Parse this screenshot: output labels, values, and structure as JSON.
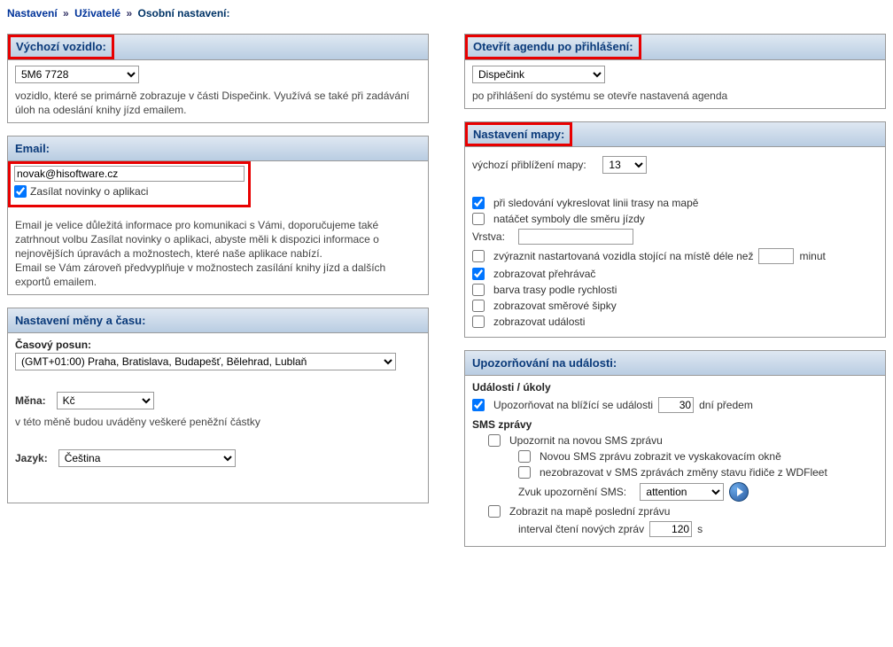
{
  "breadcrumb": {
    "link1": "Nastavení",
    "link2": "Uživatelé",
    "current": "Osobní nastavení:"
  },
  "vehicle": {
    "header": "Výchozí vozidlo:",
    "selected": "5M6 7728",
    "desc": "vozidlo, které se primárně zobrazuje v části Dispečink. Využívá se také při zadávání úloh na odeslání knihy jízd emailem."
  },
  "agenda": {
    "header": "Otevřít agendu po přihlášení:",
    "selected": "Dispečink",
    "desc": "po přihlášení do systému se otevře nastavená agenda"
  },
  "email": {
    "header": "Email:",
    "value": "novak@hisoftware.cz",
    "newsletter": "Zasílat novinky o aplikaci",
    "desc": "Email je velice důležitá informace pro komunikaci s Vámi, doporučujeme také zatrhnout volbu Zasílat novinky o aplikaci, abyste měli k dispozici informace o nejnovějších úpravách a možnostech, které naše aplikace nabízí.\nEmail se Vám zároveň předvyplňuje v možnostech zasílání knihy jízd a dalších exportů emailem."
  },
  "map": {
    "header": "Nastavení mapy:",
    "zoom_label": "výchozí přiblížení mapy:",
    "zoom": "13",
    "track_line": "při sledování vykreslovat linii trasy na mapě",
    "rotate_symbols": "natáčet symboly dle směru jízdy",
    "layer_label": "Vrstva:",
    "layer": "",
    "highlight_label_pre": "zvýraznit nastartovaná vozidla stojící na místě déle než",
    "highlight_val": "",
    "highlight_label_post": "minut",
    "player": "zobrazovat přehrávač",
    "color_speed": "barva trasy podle rychlosti",
    "arrows": "zobrazovat směrové šipky",
    "events": "zobrazovat události"
  },
  "currency": {
    "header": "Nastavení měny a času:",
    "tz_label": "Časový posun:",
    "tz": "(GMT+01:00) Praha, Bratislava, Budapešť, Bělehrad, Lublaň",
    "curr_label": "Měna:",
    "curr": "Kč",
    "curr_desc": "v této měně budou uváděny veškeré peněžní částky",
    "lang_label": "Jazyk:",
    "lang": "Čeština"
  },
  "notify": {
    "header": "Upozorňování na události:",
    "events_head": "Události / úkoly",
    "notify_upcoming_pre": "Upozorňovat na blížící se události",
    "days": "30",
    "notify_upcoming_post": "dní předem",
    "sms_head": "SMS zprávy",
    "sms_new": "Upozornit na novou SMS zprávu",
    "sms_popup": "Novou SMS zprávu zobrazit ve vyskakovacím okně",
    "sms_hide_state": "nezobrazovat v SMS zprávách změny stavu řidiče z WDFleet",
    "sound_label": "Zvuk upozornění SMS:",
    "sound": "attention",
    "show_last": "Zobrazit na mapě poslední zprávu",
    "interval_label": "interval čtení nových zpráv",
    "interval": "120",
    "interval_unit": "s"
  }
}
